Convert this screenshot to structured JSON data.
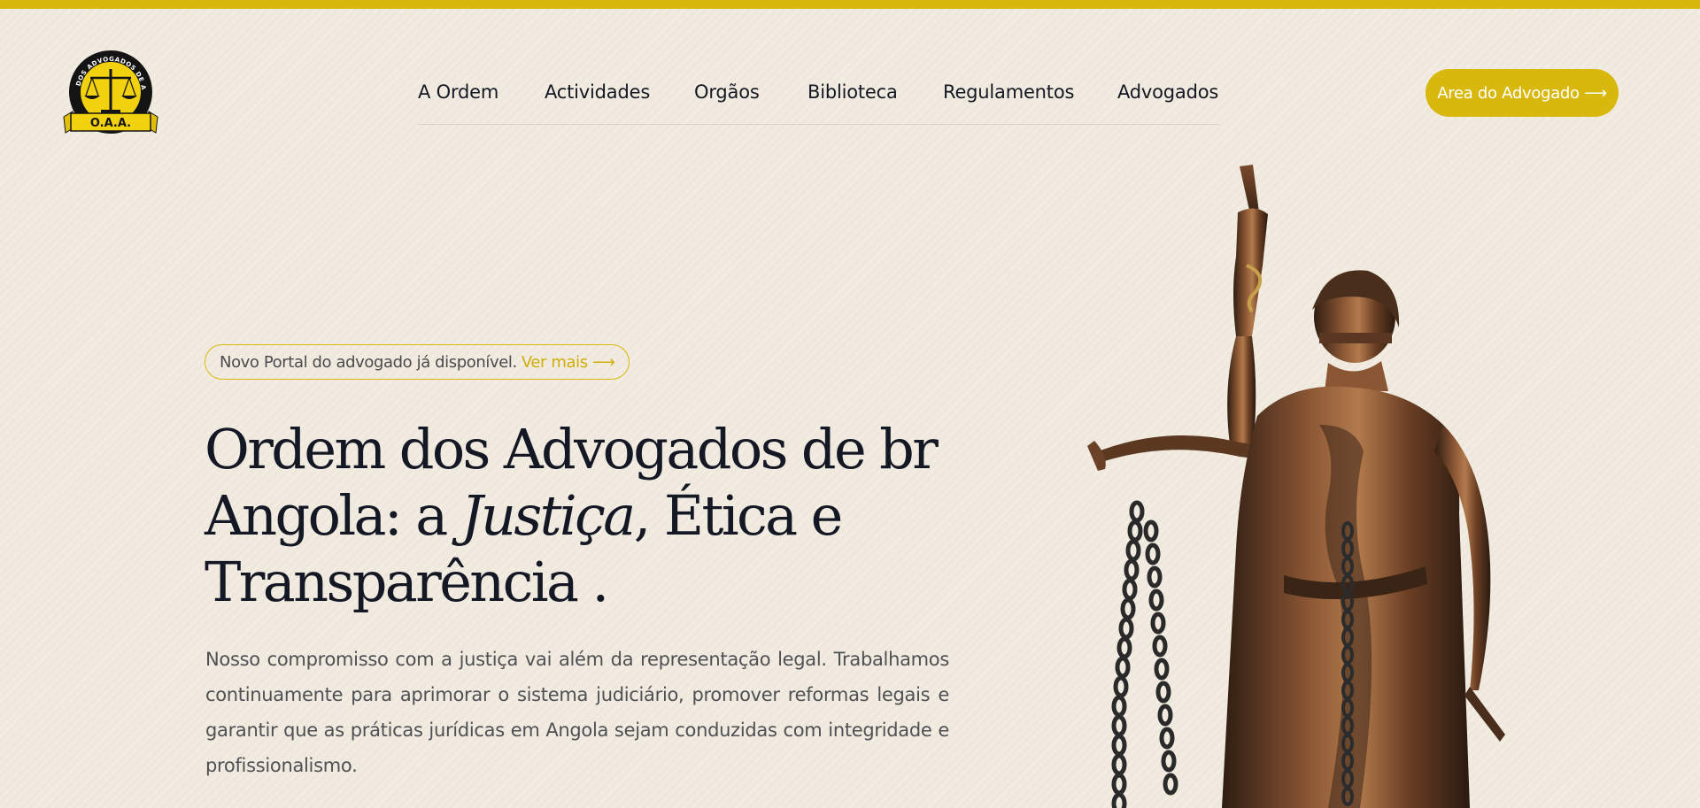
{
  "brand": {
    "logo_ring_text": "ORDEM DOS ADVOGADOS DE ANGOLA",
    "logo_banner": "O.A.A.",
    "accent_color": "#d8b80c"
  },
  "nav": {
    "items": [
      {
        "label": "A Ordem"
      },
      {
        "label": "Actividades"
      },
      {
        "label": "Orgãos"
      },
      {
        "label": "Biblioteca"
      },
      {
        "label": "Regulamentos"
      },
      {
        "label": "Advogados"
      }
    ],
    "cta_label": "Area do Advogado ⟶"
  },
  "hero": {
    "announcement_text": "Novo Portal do advogado já disponível.",
    "announcement_link": "Ver mais ⟶",
    "title_line1": "Ordem dos Advogados de br",
    "title_line2_pre": "Angola: a ",
    "title_line2_em": "Justiça",
    "title_line2_post": ", Ética e",
    "title_line3": "Transparência .",
    "description": "Nosso compromisso com a justiça vai além da representação legal. Trabalhamos continuamente para aprimorar o sistema judiciário, promover reformas legais e garantir que as práticas jurídicas em Angola sejam conduzidas com integridade e profissionalismo."
  },
  "images": {
    "hero_statue": "bronze-lady-justice-statue"
  }
}
